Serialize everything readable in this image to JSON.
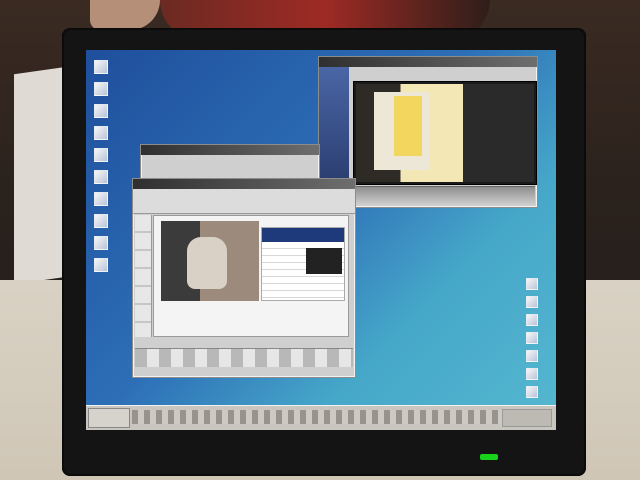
{
  "scene": {
    "type": "photo-of-laptop-screen",
    "colors": {
      "desktop_start": "#1f4f9c",
      "desktop_end": "#55b8cf",
      "taskbar": "#c9c6c0",
      "bezel": "#141414"
    }
  },
  "desktop": {
    "icons_left_count": 10,
    "icons_right_count": 7
  },
  "windows": [
    {
      "name": "video-player-window"
    },
    {
      "name": "browser-window"
    },
    {
      "name": "background-window"
    }
  ],
  "taskbar": {
    "start_icon": "start-button-icon",
    "tray_icon": "system-tray-icon"
  }
}
